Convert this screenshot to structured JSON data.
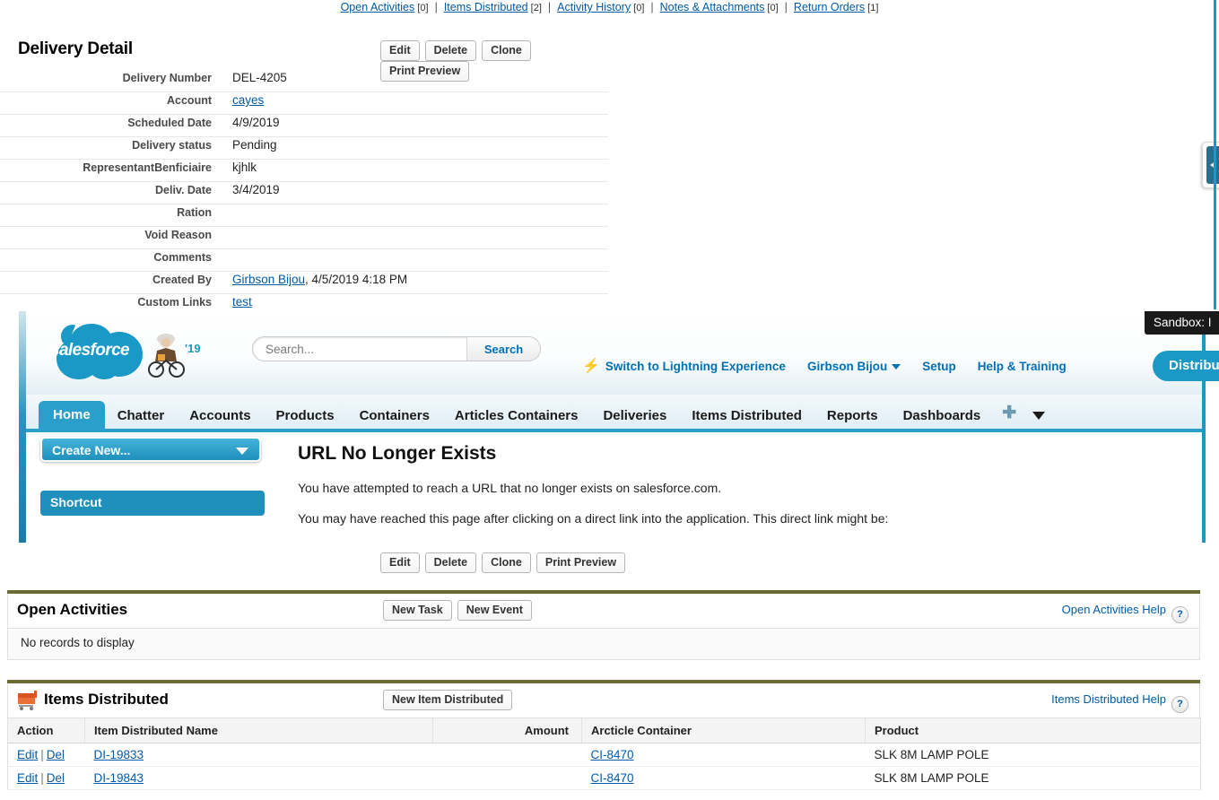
{
  "top_links": [
    {
      "label": "Open Activities",
      "count": "[0]"
    },
    {
      "label": "Items Distributed",
      "count": "[2]"
    },
    {
      "label": "Activity History",
      "count": "[0]"
    },
    {
      "label": "Notes & Attachments",
      "count": "[0]"
    },
    {
      "label": "Return Orders",
      "count": "[1]"
    }
  ],
  "detail": {
    "title": "Delivery Detail",
    "buttons": [
      "Edit",
      "Delete",
      "Clone",
      "Print Preview"
    ],
    "fields": [
      {
        "label": "Delivery Number",
        "value": "DEL-4205",
        "link": false
      },
      {
        "label": "Account",
        "value": "cayes",
        "link": true
      },
      {
        "label": "Scheduled Date",
        "value": "4/9/2019",
        "link": false
      },
      {
        "label": "Delivery status",
        "value": "Pending",
        "link": false
      },
      {
        "label": "RepresentantBenficiaire",
        "value": "kjhlk",
        "link": false
      },
      {
        "label": "Deliv. Date",
        "value": "3/4/2019",
        "link": false
      },
      {
        "label": "Ration",
        "value": "",
        "link": false
      },
      {
        "label": "Void Reason",
        "value": "",
        "link": false
      },
      {
        "label": "Comments",
        "value": "",
        "link": false
      },
      {
        "label": "Created By",
        "value": "Girbson Bijou",
        "suffix": ", 4/5/2019 4:18 PM",
        "link": true
      },
      {
        "label": "Custom Links",
        "value": "test",
        "link": true
      }
    ]
  },
  "salesforce": {
    "logo_text": "salesforce",
    "logo_year": "'19",
    "search": {
      "value": "",
      "placeholder": "Search...",
      "button_label": "Search"
    },
    "header_links": [
      {
        "label": "Switch to Lightning Experience",
        "icon": "lightning-bolt-icon"
      },
      {
        "label": "Girbson Bijou",
        "icon": "chevron-down-icon"
      },
      {
        "label": "Setup",
        "icon": ""
      },
      {
        "label": "Help & Training",
        "icon": ""
      }
    ],
    "app_button": "Distribut",
    "sandbox_banner": "Sandbox:  I",
    "tabs": [
      {
        "label": "Home",
        "active": true
      },
      {
        "label": "Chatter",
        "active": false
      },
      {
        "label": "Accounts",
        "active": false
      },
      {
        "label": "Products",
        "active": false
      },
      {
        "label": "Containers",
        "active": false
      },
      {
        "label": "Articles Containers",
        "active": false
      },
      {
        "label": "Deliveries",
        "active": false
      },
      {
        "label": "Items Distributed",
        "active": false
      },
      {
        "label": "Reports",
        "active": false
      },
      {
        "label": "Dashboards",
        "active": false
      }
    ],
    "sidebar": {
      "create_new": "Create New...",
      "shortcut": "Shortcut"
    },
    "error": {
      "title": "URL No Longer Exists",
      "line1": "You have attempted to reach a URL that no longer exists on salesforce.com.",
      "line2": "You may have reached this page after clicking on a direct link into the application. This direct link might be:"
    }
  },
  "open_activities": {
    "title": "Open Activities",
    "buttons": [
      "New Task",
      "New Event"
    ],
    "help_label": "Open Activities Help",
    "empty_text": "No records to display"
  },
  "items_distributed": {
    "title": "Items Distributed",
    "buttons": [
      "New Item Distributed"
    ],
    "help_label": "Items Distributed Help",
    "columns": [
      "Action",
      "Item Distributed Name",
      "Amount",
      "Arcticle Container",
      "Product"
    ],
    "rows": [
      {
        "edit": "Edit",
        "del": "Del",
        "name": "DI-19833",
        "amount": "",
        "container": "CI-8470",
        "product": "SLK 8M LAMP POLE"
      },
      {
        "edit": "Edit",
        "del": "Del",
        "name": "DI-19843",
        "amount": "",
        "container": "CI-8470",
        "product": "SLK 8M LAMP POLE"
      }
    ]
  },
  "colors": {
    "link": "#015ba7",
    "brand_blue": "#1a98c6",
    "rlist_rule": "#6b6b3a",
    "tab_active": "#2a9fcc"
  }
}
